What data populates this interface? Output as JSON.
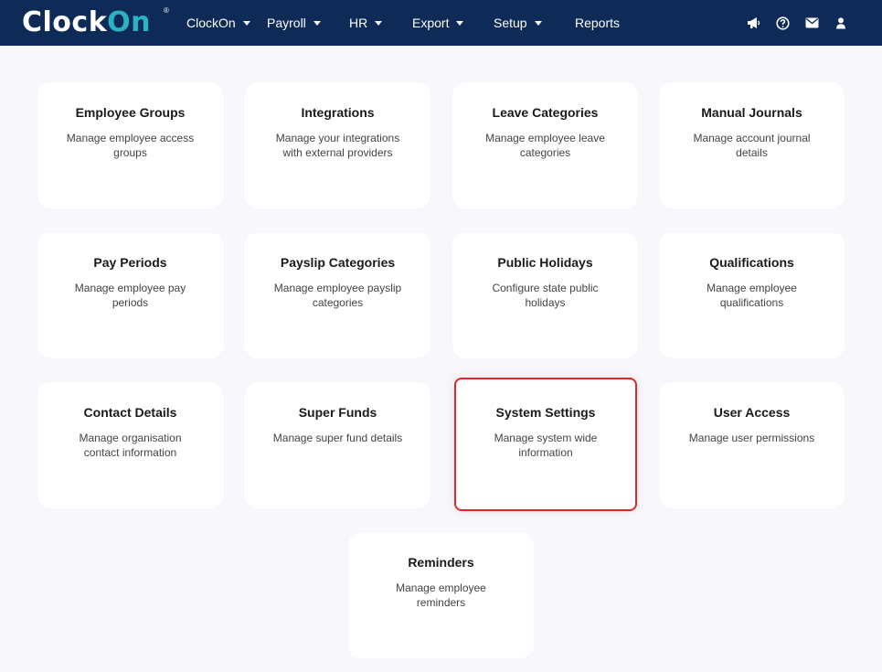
{
  "header": {
    "logo": {
      "text_part1": "Clock",
      "text_part2": "On",
      "reg": "®"
    },
    "nav": [
      {
        "label": "ClockOn",
        "dropdown": true
      },
      {
        "label": "Payroll",
        "dropdown": true
      },
      {
        "label": "HR",
        "dropdown": true
      },
      {
        "label": "Export",
        "dropdown": true
      },
      {
        "label": "Setup",
        "dropdown": true
      },
      {
        "label": "Reports",
        "dropdown": false
      }
    ],
    "icons": [
      "megaphone-icon",
      "help-icon",
      "mail-icon",
      "user-icon"
    ]
  },
  "cards": [
    {
      "title": "Employee Groups",
      "desc": "Manage employee access groups"
    },
    {
      "title": "Integrations",
      "desc": "Manage your integrations with external providers"
    },
    {
      "title": "Leave Categories",
      "desc": "Manage employee leave categories"
    },
    {
      "title": "Manual Journals",
      "desc": "Manage account journal details"
    },
    {
      "title": "Pay Periods",
      "desc": "Manage employee pay periods"
    },
    {
      "title": "Payslip Categories",
      "desc": "Manage employee payslip categories"
    },
    {
      "title": "Public Holidays",
      "desc": "Configure state public holidays"
    },
    {
      "title": "Qualifications",
      "desc": "Manage employee qualifications"
    },
    {
      "title": "Contact Details",
      "desc": "Manage organisation contact information"
    },
    {
      "title": "Super Funds",
      "desc": "Manage super fund details"
    },
    {
      "title": "System Settings",
      "desc": "Manage system wide information",
      "highlighted": true
    },
    {
      "title": "User Access",
      "desc": "Manage user permissions"
    },
    {
      "title": "Reminders",
      "desc": "Manage employee reminders"
    }
  ],
  "colors": {
    "header_bg": "#0e2a57",
    "page_bg": "#f7f7fc",
    "highlight_border": "#e02828",
    "logo_accent": "#2bb3c4"
  }
}
